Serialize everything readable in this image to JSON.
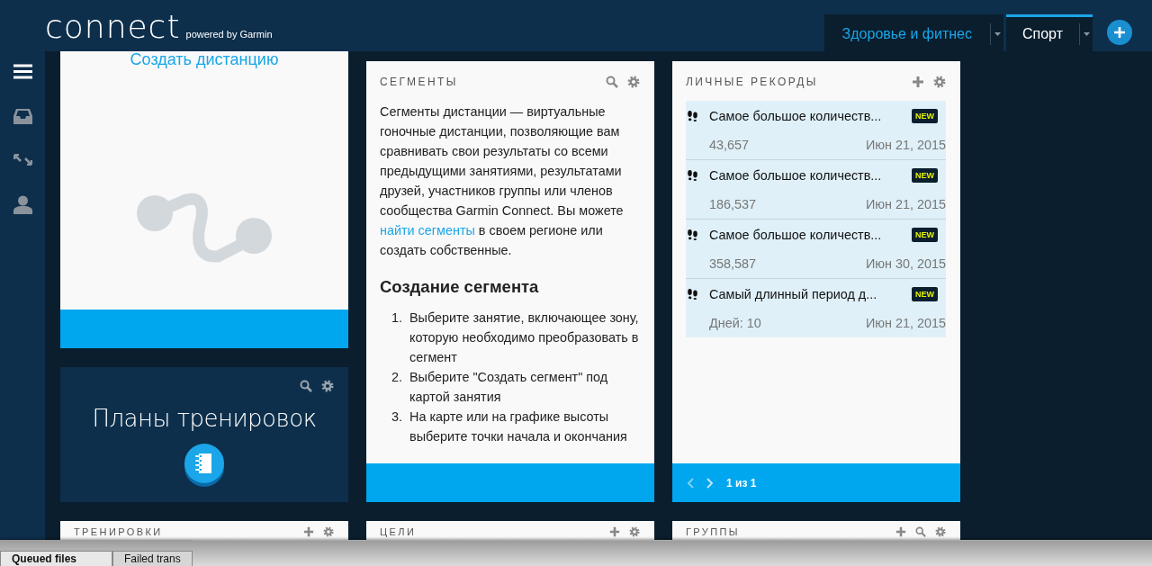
{
  "header": {
    "logo": "connect",
    "tagline": "powered by Garmin",
    "tabs": [
      {
        "label": "Здоровье и фитнес",
        "selected": false
      },
      {
        "label": "Спорт",
        "selected": true
      }
    ]
  },
  "course_card": {
    "link": "Создать дистанцию"
  },
  "plans_card": {
    "title": "Планы тренировок"
  },
  "segments_card": {
    "title": "СЕГМЕНТЫ",
    "paragraph_before": "Сегменты дистанции — виртуальные гоночные дистанции, позволяющие вам сравнивать свои результаты со всеми предыдущими занятиями, результатами друзей, участников группы или членов сообщества Garmin Connect. Вы можете ",
    "paragraph_link": "найти сегменты",
    "paragraph_after": " в своем регионе или создать собственные.",
    "heading": "Создание сегмента",
    "steps": [
      {
        "number": "1.",
        "text": "Выберите занятие, включающее зону, которую необходимо преобразовать в сегмент"
      },
      {
        "number": "2.",
        "text": "Выберите \"Создать сегмент\" под картой занятия"
      },
      {
        "number": "3.",
        "text": "На карте или на графике высоты выберите точки начала и окончания"
      }
    ]
  },
  "records_card": {
    "title": "ЛИЧНЫЕ РЕКОРДЫ",
    "items": [
      {
        "name": "Самое большое количеств...",
        "badge": "NEW",
        "value": "43,657",
        "date": "Июн 21, 2015"
      },
      {
        "name": "Самое большое количеств...",
        "badge": "NEW",
        "value": "186,537",
        "date": "Июн 21, 2015"
      },
      {
        "name": "Самое большое количеств...",
        "badge": "NEW",
        "value": "358,587",
        "date": "Июн 30, 2015"
      },
      {
        "name": "Самый длинный период д...",
        "badge": "NEW",
        "value": "Дней: 10",
        "date": "Июн 21, 2015"
      }
    ],
    "pager": "1 из 1"
  },
  "bottom_cards": [
    {
      "title": "ТРЕНИРОВКИ",
      "tools": [
        {
          "kind": "plus"
        },
        {
          "kind": "gear"
        }
      ]
    },
    {
      "title": "ЦЕЛИ",
      "tools": [
        {
          "kind": "plus"
        },
        {
          "kind": "gear"
        }
      ]
    },
    {
      "title": "ГРУППЫ",
      "tools": [
        {
          "kind": "plus"
        },
        {
          "kind": "search"
        },
        {
          "kind": "gear"
        }
      ]
    }
  ],
  "overlay_window": {
    "tabs": [
      {
        "label": "Queued files",
        "selected": true
      },
      {
        "label": "Failed trans",
        "selected": false
      }
    ]
  }
}
